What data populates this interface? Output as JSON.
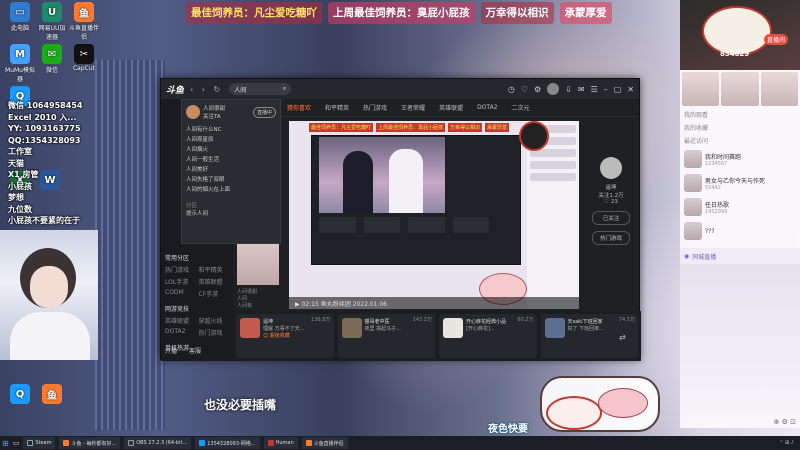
{
  "banners": [
    "最佳饲养员：凡尘爱吃糖吖",
    "上周最佳饲养员：臭屁小屁孩",
    "万幸得以相识",
    "承蒙厚爱"
  ],
  "desktop_icons": [
    {
      "label": "此电脑",
      "color": "#2e7bcf",
      "glyph": "▭"
    },
    {
      "label": "网易UU加速器",
      "color": "#1f8a6a",
      "glyph": "U"
    },
    {
      "label": "斗鱼直播伴侣",
      "color": "#ff7a2f",
      "glyph": "鱼"
    },
    {
      "label": "MuMu模拟器",
      "color": "#46a0ff",
      "glyph": "M"
    },
    {
      "label": "微信",
      "color": "#1aad19",
      "glyph": "✉"
    },
    {
      "label": "CapCut",
      "color": "#111111",
      "glyph": "✂"
    },
    {
      "label": "QQ",
      "color": "#1a9bfc",
      "glyph": "Q"
    },
    {
      "label": "Word",
      "color": "#2b579a",
      "glyph": "W"
    },
    {
      "label": "Excel",
      "color": "#1d6f42",
      "glyph": "X"
    }
  ],
  "overlay_lines": [
    "微信 1064958454",
    "Excel 2010  入...",
    "YY: 1093163775",
    "QQ:1354328093",
    "工作室",
    "天猫",
    "X1 房管",
    "小屁孩",
    "梦想",
    "九位数",
    "小屁孩不要紧的在于"
  ],
  "app": {
    "logo": "斗鱼",
    "nav": "‹ › ↻",
    "search_value": "人间",
    "categories": [
      "猜你喜欢",
      "和平精英",
      "热门游戏",
      "王者荣耀",
      "英雄联盟",
      "DOTA2",
      "二次元"
    ],
    "sidebar": {
      "groups": [
        {
          "title": "常用分区",
          "items": [
            "热门游戏",
            "和平精英",
            "LOL手游",
            "英雄联盟",
            "CODM",
            "CF手游"
          ]
        },
        {
          "title": "网游竞技",
          "items": [
            "英雄联盟",
            "穿越火线",
            "DOTA2",
            "热门游戏",
            "CF手游",
            "CNF"
          ]
        },
        {
          "title": "单机热游",
          "items": [
            "主机游戏",
            "单机游戏"
          ]
        }
      ],
      "bottom": [
        "开播",
        "客服"
      ]
    },
    "dropdown": {
      "user_name": "人间很甜",
      "user_sub": "关注TA",
      "follow_label": "直播中",
      "suggestions": [
        "人间有什么NC",
        "人间观星辰",
        "人间烟火",
        "人间一般生活",
        "人间美好",
        "人间失格了双眼",
        "人间的烟火在上面"
      ],
      "section": "分区",
      "section_item": "提示人间"
    },
    "player_top": [
      "最佳饲养员：凡尘爱吃糖吖",
      "上周最佳饲养员：臭屁小屁孩",
      "万幸得以相识",
      "承蒙厚爱"
    ],
    "caption": "▶ 02:15  鱼丸粉丝团  2022.01.06",
    "host": {
      "name": "遥坤",
      "fans": "关注1.2万",
      "likes": "♡ 23",
      "follow_btn": "已关注",
      "hot_btn": "热门游戏"
    },
    "left_list": [
      "人间很甜",
      "人间",
      "人间有"
    ],
    "previews": [
      {
        "title": "遥坤",
        "sub": "理解 万事不了天...",
        "badge": "136.8万"
      },
      {
        "title": "猫哥老中医",
        "sub": "夜里 揭起马子...",
        "badge": "143.2万"
      },
      {
        "title": "开心麻花经典小品",
        "sub": "[开心麻花]...",
        "badge": "60.2万"
      },
      {
        "title": "天saki下班回家",
        "sub": "好了 下班回家...",
        "badge": "74.5万"
      }
    ],
    "previews_label": "☺ 超级收藏"
  },
  "chat": {
    "tag": "854029",
    "live_btn": "直播间",
    "section1": "我的观看",
    "section2": "我的收藏",
    "section3": "最近访问",
    "rows": [
      {
        "name": "我和时间赛跑",
        "sub": "1234567"
      },
      {
        "name": "男女与乙你今天与作死",
        "sub": "55442"
      },
      {
        "name": "任日热歌",
        "sub": "1452999"
      },
      {
        "name": "???",
        "sub": ""
      }
    ],
    "footer": "同城直播",
    "corner_icons": "⊕ ⚙ ⊡"
  },
  "subtitles": {
    "left": "也没必要插嘴",
    "right": "夜色快要"
  },
  "taskbar": {
    "tasks": [
      {
        "label": "Steam",
        "color": "#1b2838"
      },
      {
        "label": "斗鱼 - 每秒都有好...",
        "color": "#ff7a2f"
      },
      {
        "label": "OBS 27.2.3 (64-bit...",
        "color": "#333333"
      },
      {
        "label": "1354328093-网络...",
        "color": "#1a9bfc"
      },
      {
        "label": "Human",
        "color": "#c0392b"
      },
      {
        "label": "斗鱼直播伴侣",
        "color": "#ff7a2f"
      }
    ],
    "tray": "⌃ ⊞ ♪"
  }
}
